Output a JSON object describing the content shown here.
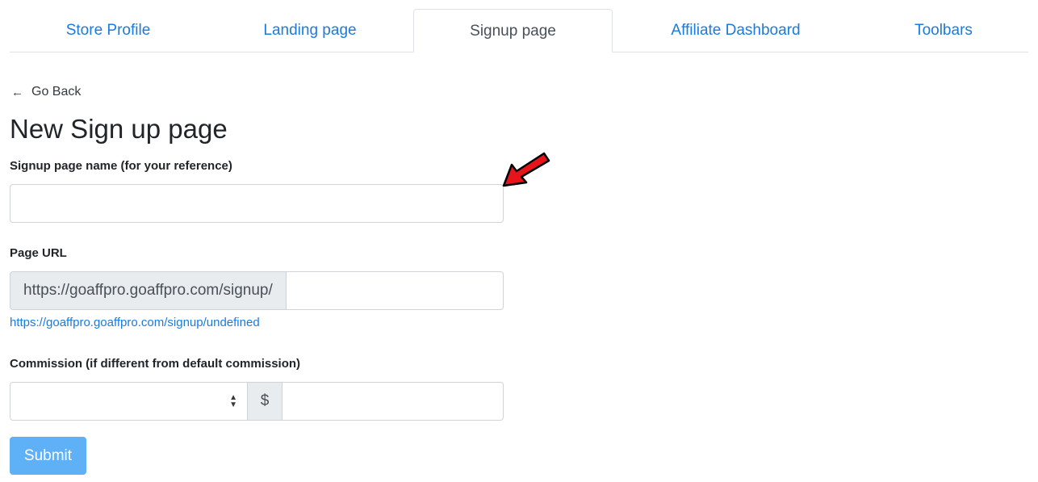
{
  "tabs": [
    {
      "label": "Store Profile"
    },
    {
      "label": "Landing page"
    },
    {
      "label": "Signup page",
      "active": true
    },
    {
      "label": "Affiliate Dashboard"
    },
    {
      "label": "Toolbars"
    }
  ],
  "goback": {
    "arrow": "←",
    "label": "Go Back"
  },
  "page_title": "New Sign up page",
  "form": {
    "name_label": "Signup page name (for your reference)",
    "name_value": "",
    "url_label": "Page URL",
    "url_prefix": "https://goaffpro.goaffpro.com/signup/",
    "url_value": "",
    "url_preview": "https://goaffpro.goaffpro.com/signup/undefined",
    "commission_label": "Commission (if different from default commission)",
    "commission_type_selected": "",
    "currency_symbol": "$",
    "commission_value": "",
    "submit_label": "Submit"
  },
  "colors": {
    "link": "#1a7be0",
    "submit_bg": "#5eb0f7",
    "annotation_arrow": "#e8141b"
  },
  "icons": {
    "annotation": "red-arrow-pointer-icon",
    "select": "select-caret-icon"
  }
}
